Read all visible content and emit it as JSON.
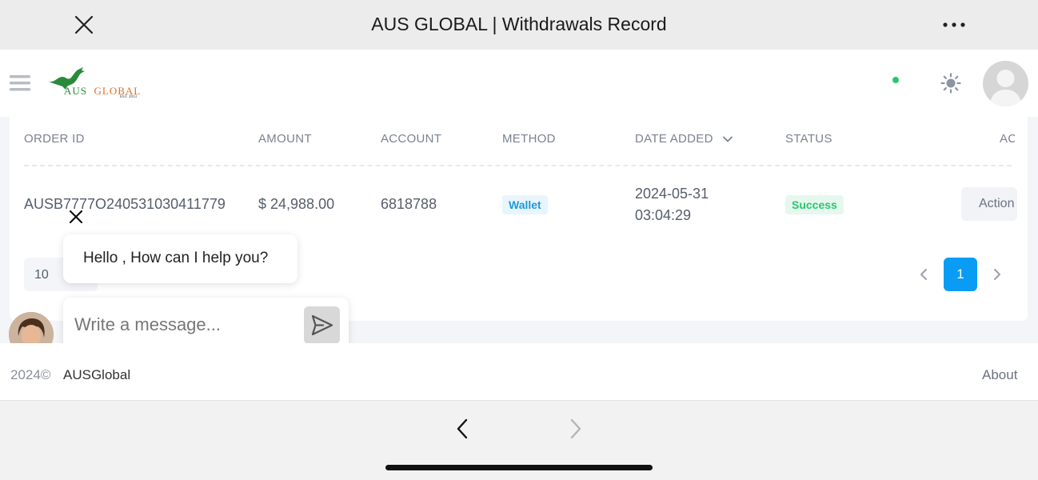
{
  "browser": {
    "title": "AUS GLOBAL | Withdrawals Record",
    "close_icon": "close-icon",
    "more_icon": "more-horizontal-icon"
  },
  "header": {
    "menu_icon": "hamburger-menu-icon",
    "logo": {
      "word1": "AUS",
      "word2": "GLOBAL",
      "est": "EST. 2013",
      "color_green": "#2a8a3a",
      "color_orange": "#e0722a"
    },
    "status_color": "#28c76f",
    "theme_icon": "sun-icon",
    "avatar_icon": "user-avatar-icon"
  },
  "table": {
    "columns": [
      "ORDER ID",
      "AMOUNT",
      "ACCOUNT",
      "METHOD",
      "DATE ADDED",
      "STATUS",
      "AC"
    ],
    "rows": [
      {
        "order_id": "AUSB7777O240531030411779",
        "amount": "$ 24,988.00",
        "account": "6818788",
        "method": "Wallet",
        "date": "2024-05-31",
        "time": "03:04:29",
        "status": "Success",
        "action": "Action"
      }
    ]
  },
  "pagination": {
    "page_size": "10",
    "current_page": "1",
    "accent": "#0a9cf5"
  },
  "chat": {
    "greeting": "Hello , How can I help you?",
    "placeholder": "Write a message..."
  },
  "footer": {
    "copyright": "2024©",
    "brand": "AUSGlobal",
    "about": "About"
  },
  "nav": {
    "back_icon": "chevron-left-icon",
    "forward_icon": "chevron-right-icon"
  }
}
